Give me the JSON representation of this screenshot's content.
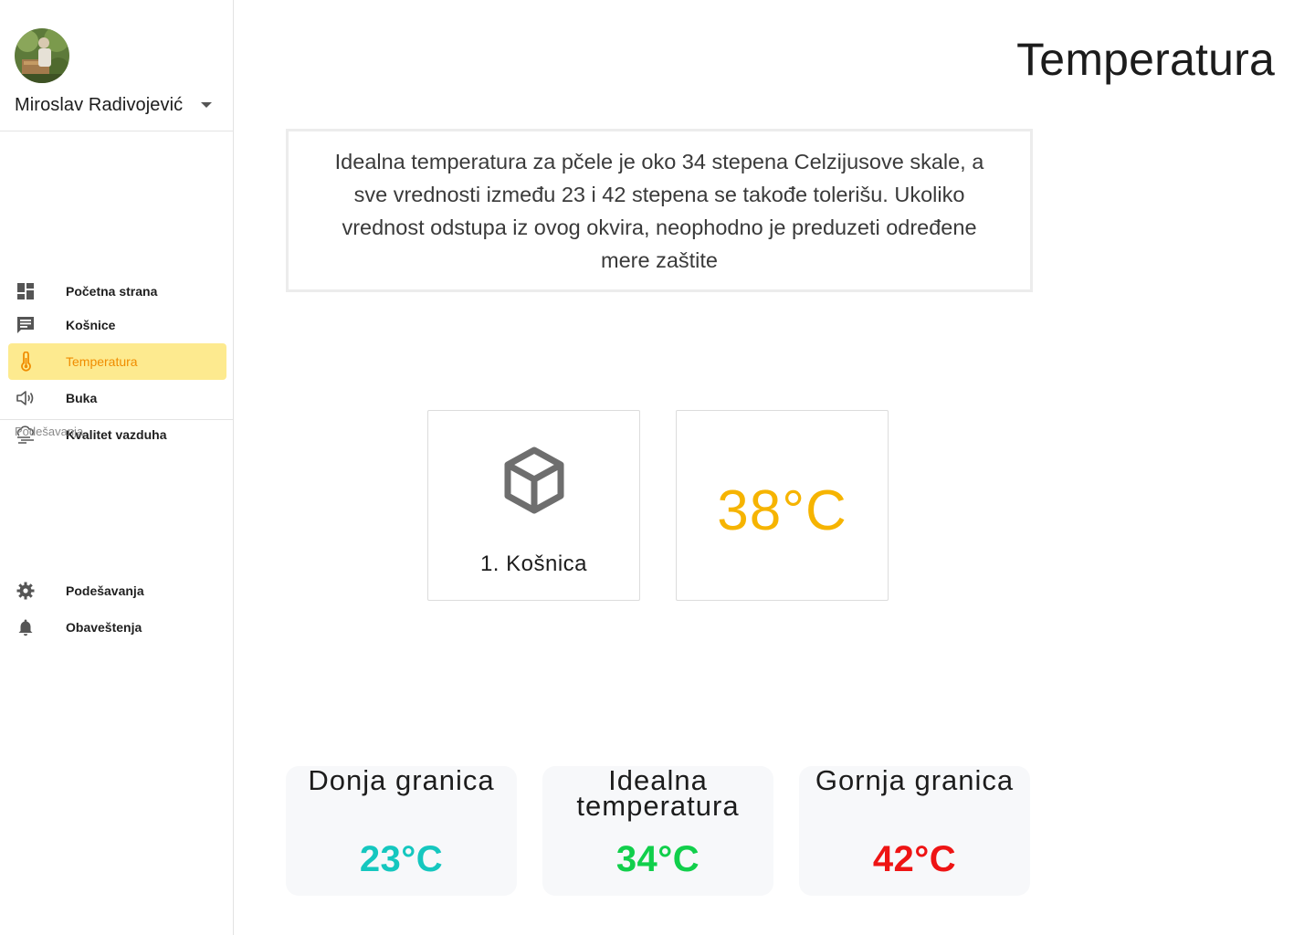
{
  "user": {
    "name": "Miroslav Radivojević"
  },
  "nav": {
    "items": [
      {
        "label": "Početna strana",
        "icon": "dashboard-icon"
      },
      {
        "label": "Košnice",
        "icon": "message-icon"
      },
      {
        "label": "Temperatura",
        "icon": "thermometer-icon",
        "active": true
      },
      {
        "label": "Buka",
        "icon": "speaker-icon"
      },
      {
        "label": "Kvalitet vazduha",
        "icon": "air-quality-icon"
      }
    ],
    "settings_section": "Podešavanja",
    "settings_items": [
      {
        "label": "Podešavanja",
        "icon": "gear-icon"
      },
      {
        "label": "Obaveštenja",
        "icon": "bell-icon"
      }
    ]
  },
  "page": {
    "title": "Temperatura",
    "info": "Idealna temperatura za pčele je oko 34 stepena Celzijusove skale, a sve vrednosti između 23 i 42 stepena se takođe tolerišu. Ukoliko vrednost odstupa iz ovog okvira, neophodno je preduzeti određene mere zaštite"
  },
  "hive": {
    "label": "1. Košnica",
    "temperature": "38°C",
    "temperature_color": "#f6b400"
  },
  "limits": [
    {
      "title": "Donja granica",
      "value": "23°C",
      "color": "#15c7bf"
    },
    {
      "title": "Idealna temperatura",
      "value": "34°C",
      "color": "#11cf4b"
    },
    {
      "title": "Gornja granica",
      "value": "42°C",
      "color": "#ee1414"
    }
  ],
  "colors": {
    "accent": "#f08c00",
    "active_bg": "#fdea8f"
  }
}
